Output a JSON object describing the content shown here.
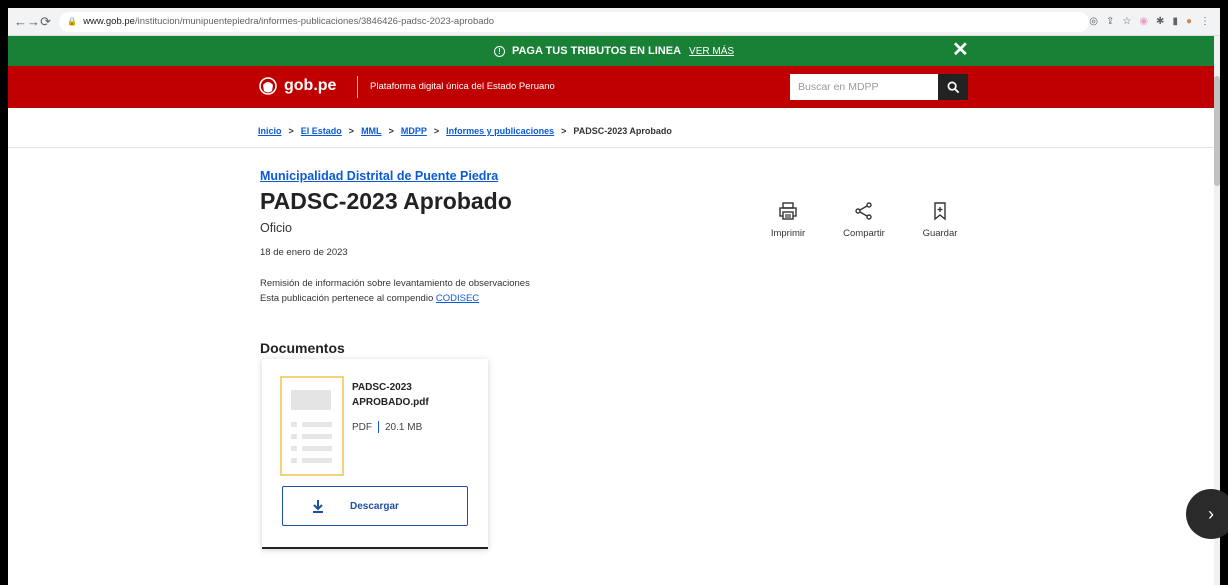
{
  "browser": {
    "url_domain": "www.gob.pe",
    "url_path": "/institucion/munipuentepiedra/informes-publicaciones/3846426-padsc-2023-aprobado"
  },
  "banner": {
    "text": "PAGA TUS TRIBUTOS EN LINEA",
    "link": "VER MÁS",
    "bg": "#198136"
  },
  "header": {
    "brand": "gob.pe",
    "tagline": "Plataforma digital única del Estado Peruano",
    "search_placeholder": "Buscar en MDPP",
    "bg": "#c00000"
  },
  "breadcrumb": {
    "items": [
      "Inicio",
      "El Estado",
      "MML",
      "MDPP",
      "Informes y publicaciones"
    ],
    "current": "PADSC-2023 Aprobado"
  },
  "main": {
    "org": "Municipalidad Distrital de Puente Piedra",
    "title": "PADSC-2023 Aprobado",
    "type": "Oficio",
    "date": "18 de enero de 2023",
    "desc": "Remisión de información sobre levantamiento de observaciones",
    "compendium_prefix": "Esta publicación pertenece al compendio",
    "compendium_link": "CODISEC"
  },
  "actions": {
    "print": "Imprimir",
    "share": "Compartir",
    "save": "Guardar"
  },
  "documents": {
    "heading": "Documentos",
    "file_name": "PADSC-2023 APROBADO.pdf",
    "file_type": "PDF",
    "file_size": "20.1 MB",
    "download": "Descargar"
  }
}
